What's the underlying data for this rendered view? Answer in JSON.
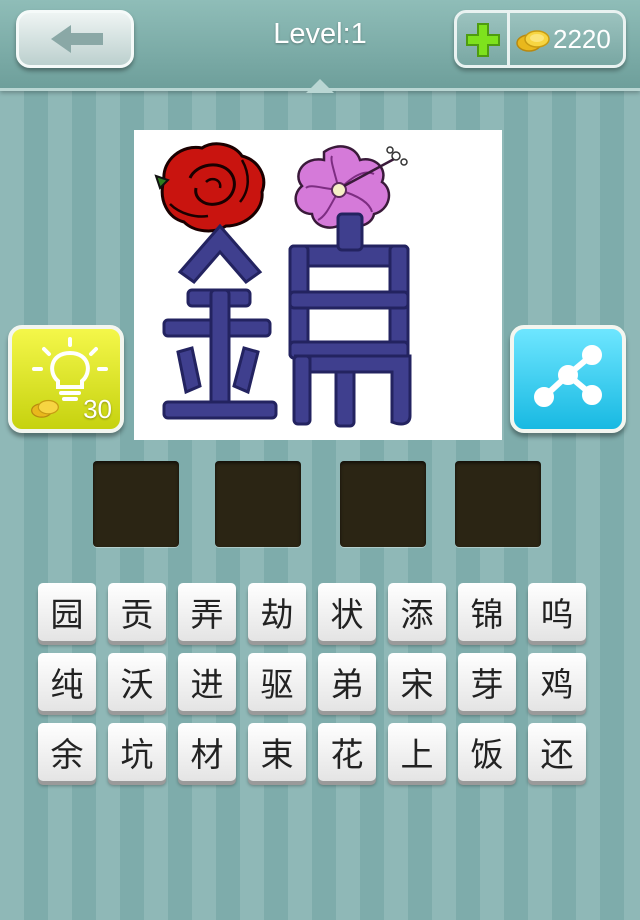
{
  "header": {
    "back_icon": "arrow-left-icon",
    "level_label": "Level:1",
    "add_coins_icon": "plus-icon",
    "coin_icon": "gold-coins-icon",
    "coin_count": "2220"
  },
  "puzzle": {
    "picture_icon": "rose-and-hibiscus-over-character-image",
    "answer_slots": [
      "",
      "",
      "",
      ""
    ]
  },
  "hint": {
    "icon": "lightbulb-icon",
    "cost": "30"
  },
  "share": {
    "icon": "share-icon"
  },
  "letters": {
    "rows": [
      [
        "园",
        "贡",
        "弄",
        "劫",
        "状",
        "添",
        "锦",
        "呜"
      ],
      [
        "纯",
        "沃",
        "进",
        "驱",
        "弟",
        "宋",
        "芽",
        "鸡"
      ],
      [
        "余",
        "坑",
        "材",
        "束",
        "花",
        "上",
        "饭",
        "还"
      ]
    ]
  },
  "colors": {
    "background": "#8fb8b7",
    "slot": "#2b2514",
    "hint_button": "#e3e92b",
    "share_button": "#3ccdf0"
  }
}
